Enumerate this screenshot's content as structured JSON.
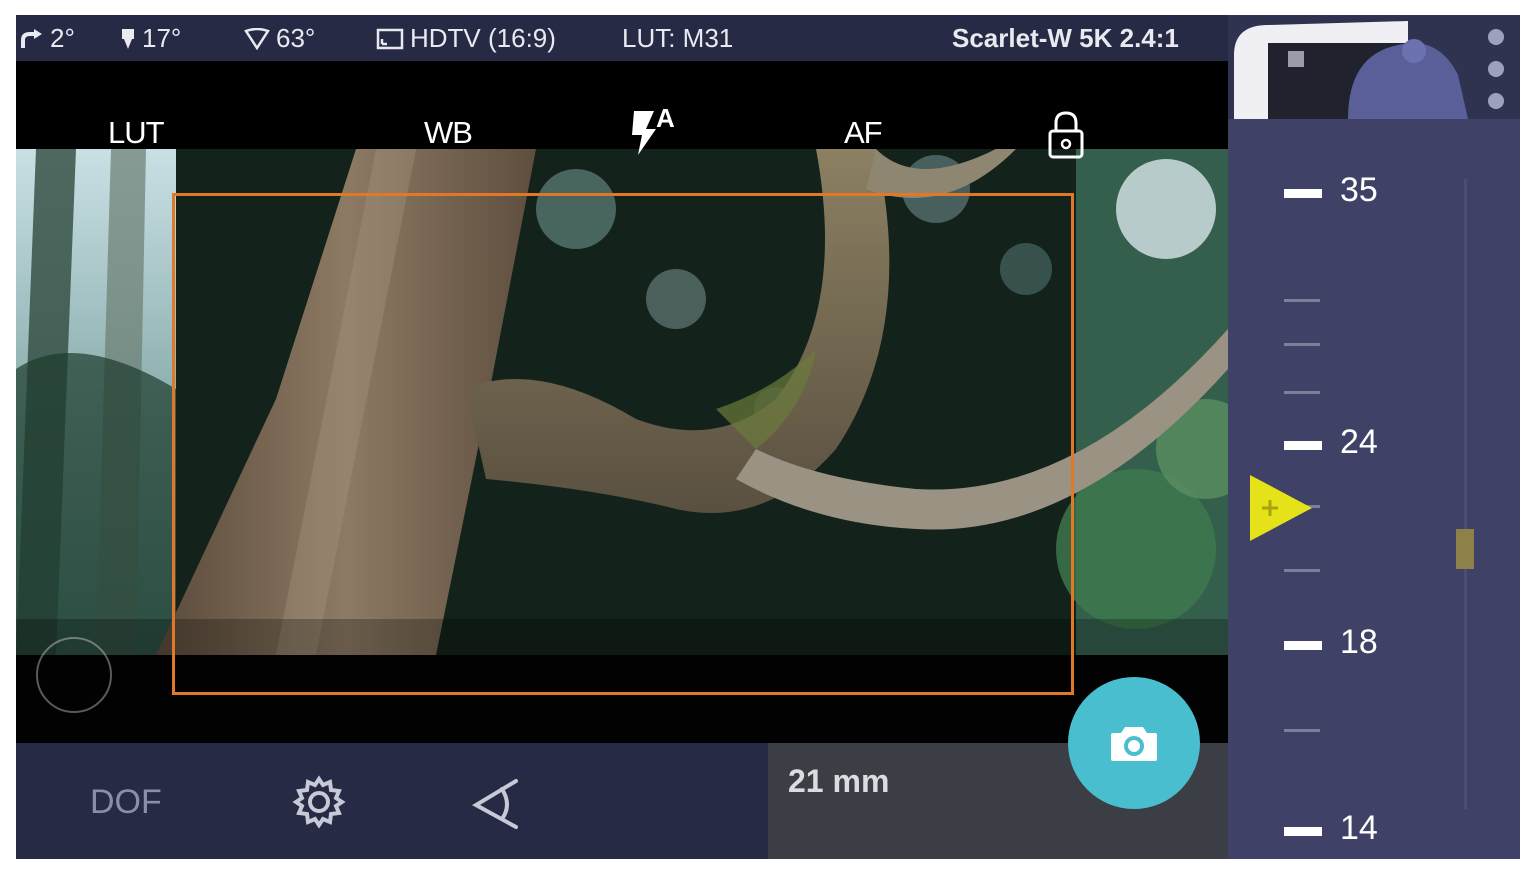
{
  "status_bar": {
    "tilt": "2°",
    "roll": "17°",
    "field_of_view": "63°",
    "aspect": "HDTV (16:9)",
    "lut": "LUT: M31",
    "camera_format": "Scarlet-W 5K 2.4:1"
  },
  "viewfinder": {
    "lut_label": "LUT",
    "wb_label": "WB",
    "flash_mode": "A",
    "af_label": "AF"
  },
  "bottom_bar": {
    "dof_label": "DOF",
    "focal_length": "21 mm"
  },
  "focal_ruler": {
    "labels": [
      "35",
      "24",
      "18",
      "14"
    ],
    "current_focal_length_mm": 21
  },
  "colors": {
    "panel": "#262a44",
    "ruler_panel": "#3f4266",
    "frame_guide": "#e17828",
    "capture_button": "#49bece",
    "zoom_pointer": "#e6e21a"
  },
  "icons": [
    "tilt-icon",
    "roll-icon",
    "field-of-view-icon",
    "aspect-icon",
    "flash-auto-icon",
    "lock-icon",
    "settings-icon",
    "angle-icon",
    "camera-icon",
    "more-vertical-icon",
    "pointer-icon"
  ]
}
